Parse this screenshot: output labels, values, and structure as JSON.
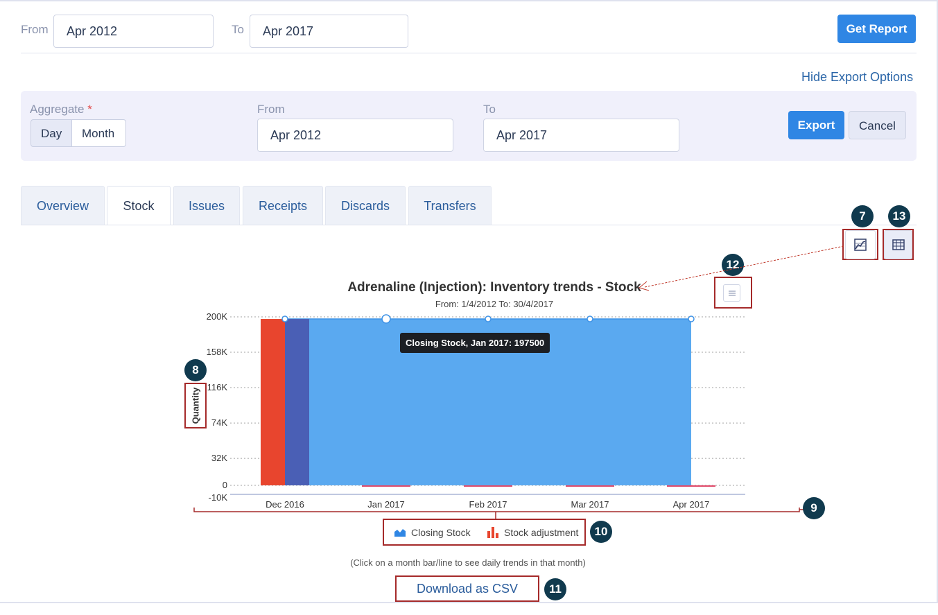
{
  "filters": {
    "from_label": "From",
    "from_value": "Apr 2012",
    "to_label": "To",
    "to_value": "Apr 2017",
    "get_report_label": "Get Report"
  },
  "export": {
    "toggle_link": "Hide Export Options",
    "aggregate_label": "Aggregate",
    "required_mark": "*",
    "aggregate_options": [
      "Day",
      "Month"
    ],
    "aggregate_selected": "Month",
    "from_label": "From",
    "from_value": "Apr 2012",
    "to_label": "To",
    "to_value": "Apr 2017",
    "export_label": "Export",
    "cancel_label": "Cancel"
  },
  "tabs": [
    {
      "label": "Overview",
      "active": false
    },
    {
      "label": "Stock",
      "active": true
    },
    {
      "label": "Issues",
      "active": false
    },
    {
      "label": "Receipts",
      "active": false
    },
    {
      "label": "Discards",
      "active": false
    },
    {
      "label": "Transfers",
      "active": false
    }
  ],
  "view_toggle": {
    "chart_icon": "chart-icon",
    "table_icon": "table-icon",
    "menu_icon": "hamburger-menu-icon"
  },
  "annotations": {
    "badges": [
      "7",
      "13",
      "12",
      "8",
      "9",
      "10",
      "11"
    ]
  },
  "chart_data": {
    "type": "area",
    "title": "Adrenaline (Injection): Inventory trends - Stock",
    "subtitle": "From: 1/4/2012 To: 30/4/2017",
    "ylabel": "Quantity",
    "xlabel": "",
    "categories": [
      "Dec 2016",
      "Jan 2017",
      "Feb 2017",
      "Mar 2017",
      "Apr 2017"
    ],
    "y_ticks": [
      "200K",
      "158K",
      "116K",
      "74K",
      "32K",
      "0",
      "-10K"
    ],
    "ylim": [
      -10000,
      200000
    ],
    "series": [
      {
        "name": "Closing Stock",
        "type": "area",
        "color": "#5aa9f0",
        "values": [
          197500,
          197500,
          197500,
          197500,
          197500
        ]
      },
      {
        "name": "Stock adjustment",
        "type": "bar",
        "color": "#e8452e",
        "values": [
          197500,
          -500,
          -500,
          -500,
          -500
        ]
      }
    ],
    "extra_bar": {
      "color": "#4a5fb5",
      "value": 197500
    },
    "tooltip": "Closing Stock, Jan 2017: 197500",
    "legend_position": "bottom",
    "grid": true
  },
  "hint": "(Click on a month bar/line to see daily trends in that month)",
  "download_label": "Download as CSV"
}
